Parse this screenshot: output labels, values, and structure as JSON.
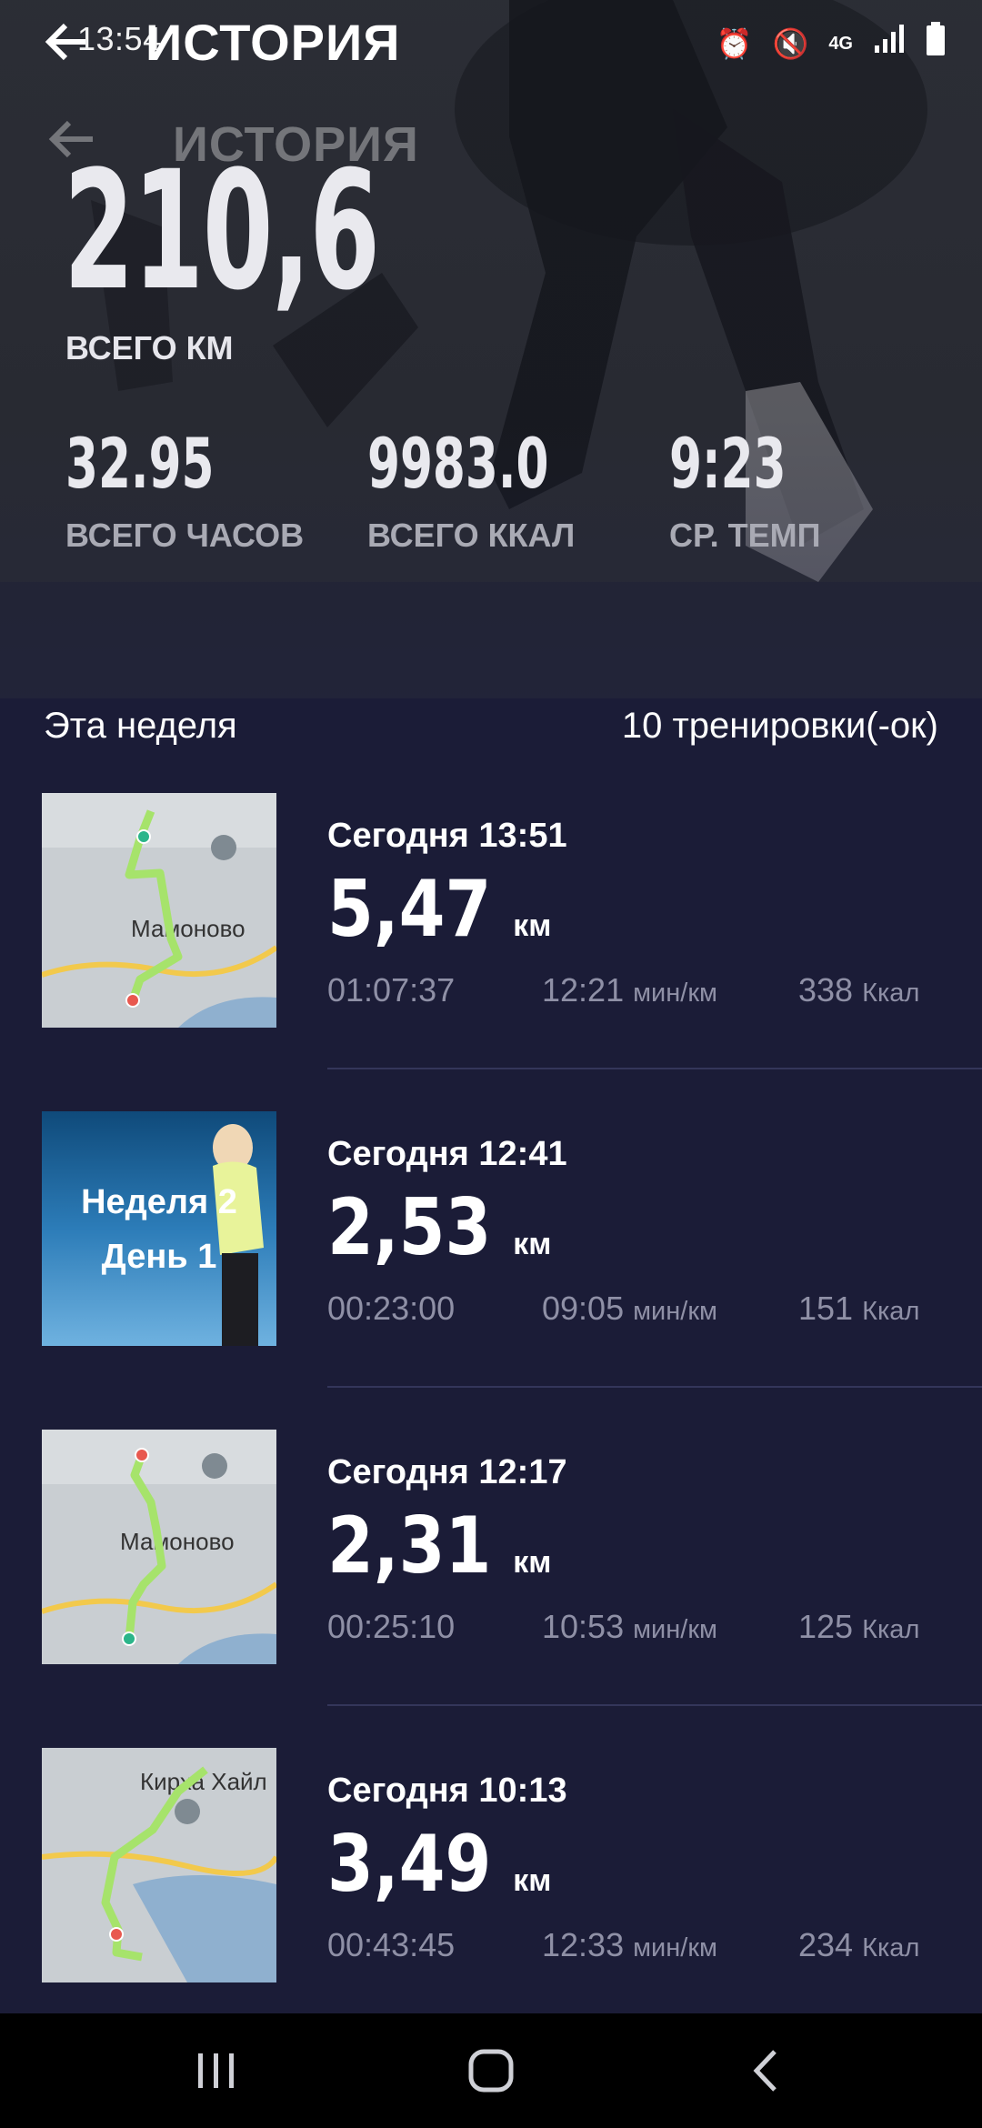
{
  "status_bar": {
    "time": "13:54",
    "icons": [
      "alarm-icon",
      "mute-icon",
      "4g-icon",
      "signal-icon",
      "battery-icon"
    ]
  },
  "header": {
    "title": "ИСТОРИЯ"
  },
  "summary": {
    "total_km": "210,6",
    "total_km_label": "ВСЕГО КМ",
    "stats": [
      {
        "value": "32.95",
        "label": "ВСЕГО ЧАСОВ"
      },
      {
        "value": "9983.0",
        "label": "ВСЕГО ККАЛ"
      },
      {
        "value": "9:23",
        "label": "СР. ТЕМП"
      }
    ]
  },
  "week": {
    "title": "Эта неделя",
    "count": "10 тренировки(-ок)"
  },
  "workouts": [
    {
      "thumb": "map",
      "map_label": "Мамоново",
      "date": "Сегодня 13:51",
      "distance": "5,47",
      "unit": "км",
      "duration": "01:07:37",
      "pace": "12:21",
      "pace_unit": "мин/км",
      "calories": "338",
      "cal_unit": "Ккал"
    },
    {
      "thumb": "promo",
      "promo_line1": "Неделя 2",
      "promo_line2": "День 1",
      "date": "Сегодня 12:41",
      "distance": "2,53",
      "unit": "км",
      "duration": "00:23:00",
      "pace": "09:05",
      "pace_unit": "мин/км",
      "calories": "151",
      "cal_unit": "Ккал"
    },
    {
      "thumb": "map",
      "map_label": "Мамоново",
      "date": "Сегодня 12:17",
      "distance": "2,31",
      "unit": "км",
      "duration": "00:25:10",
      "pace": "10:53",
      "pace_unit": "мин/км",
      "calories": "125",
      "cal_unit": "Ккал"
    },
    {
      "thumb": "map",
      "map_label": "Кирха Хайл",
      "date": "Сегодня 10:13",
      "distance": "3,49",
      "unit": "км",
      "duration": "00:43:45",
      "pace": "12:33",
      "pace_unit": "мин/км",
      "calories": "234",
      "cal_unit": "Ккал"
    }
  ],
  "colors": {
    "background": "#1b1c37",
    "route": "#a6e36b",
    "start_marker": "#2bb58a",
    "end_marker": "#e8584f"
  }
}
